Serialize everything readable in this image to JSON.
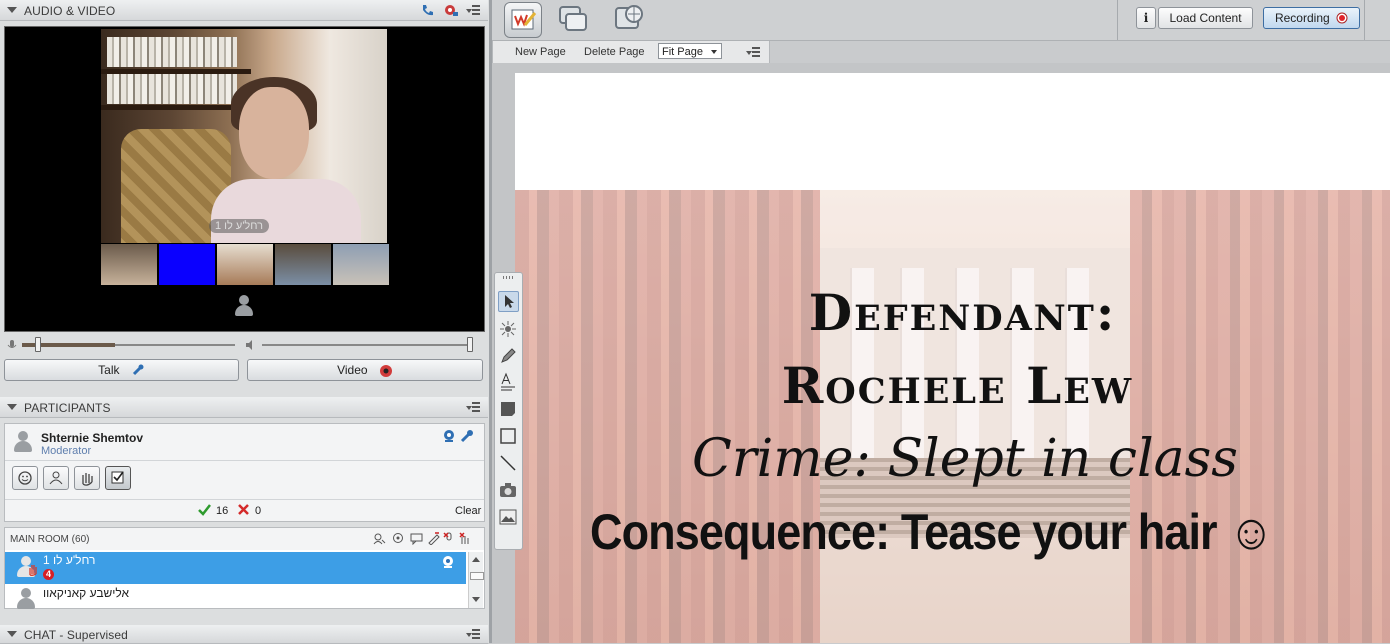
{
  "audio_video": {
    "title": "AUDIO & VIDEO",
    "main_video_label": "רחל'ע לו 1",
    "talk_label": "Talk",
    "video_label": "Video"
  },
  "participants": {
    "title": "PARTICIPANTS",
    "moderator_name": "Shternie Shemtov",
    "moderator_role": "Moderator",
    "yes_count": "16",
    "no_count": "0",
    "clear_label": "Clear",
    "room_label": "MAIN ROOM",
    "room_count": "(60)",
    "rows": [
      {
        "name": "רחל'ע לו 1",
        "badge": "4",
        "selected": true
      },
      {
        "name": "אלישבע קאניקאוו",
        "selected": false
      }
    ]
  },
  "chat": {
    "title": "CHAT - Supervised"
  },
  "toolbar": {
    "load_content": "Load Content",
    "recording": "Recording"
  },
  "page_bar": {
    "new_page": "New Page",
    "delete_page": "Delete Page",
    "zoom_value": "Fit Page"
  },
  "slide": {
    "line1": "Defendant:",
    "line2": "Rochele Lew",
    "line3": "Crime: Slept in class",
    "line4": "Consequence: Tease your hair ☺"
  },
  "colors": {
    "selection": "#3d9ee6",
    "recording_dot": "#e0232b",
    "slide_curtain": "#a12e20"
  }
}
